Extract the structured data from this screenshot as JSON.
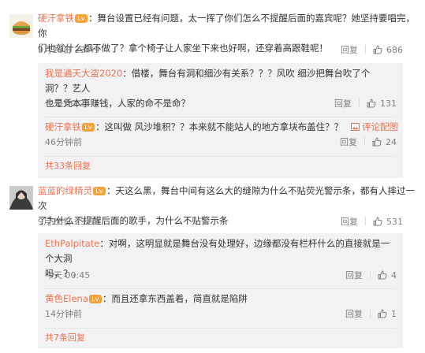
{
  "comments": [
    {
      "user": "硬汗拿铁",
      "badge": "Lv",
      "text_line1": "：舞台设置已经有问题，太一挥了你们怎么不提醒后面的嘉宾呢？她坚持要唱完，你",
      "text_line2": "们也就什么都不做了？拿个椅子让人家坐下来也好啊，还穿着高跟鞋呢！",
      "time": "9月26日 23:49",
      "reply_label": "回复",
      "likes": "686",
      "replies": [
        {
          "user": "我是通天大盗2020",
          "text_line1": "：借楼，舞台有洞和细沙有关系？？？风吹 细沙把舞台吹了个洞？？艺人",
          "text_line2": "也是凭本事赚钱，人家的命不是命？",
          "time": "今天 00:23",
          "reply_label": "回复",
          "likes": "131"
        },
        {
          "user": "硬汗拿铁",
          "badge": "Lv",
          "text_line1": "：这叫做 风沙堆积？？本来就不能站人的地方拿块布盖住？？",
          "pic_label": "评论配图",
          "time": "46分钟前",
          "reply_label": "回复",
          "likes": "24"
        }
      ],
      "more_label": "共33条回复"
    },
    {
      "user": "蓝蓝的绿精灵",
      "badge": "Lv",
      "text_line1": "：天这么黑，舞台中间有这么大的缝隙为什么不贴荧光警示条，都有人摔过一次",
      "text_line2": "了为什么不提醒后面的歌手，为什么不贴警示条",
      "time": "9月26日 23:53",
      "reply_label": "回复",
      "likes": "531",
      "replies": [
        {
          "user": "EthPalpitate",
          "text_line1": "：对啊，这明显就是舞台没有处理好，边缘都没有栏杆什么的直接就是一个大洞",
          "text_line2": "吗，？，",
          "time": "今天 00:45",
          "reply_label": "回复",
          "likes": "4"
        },
        {
          "user": "黄色Elena",
          "badge": "Lv",
          "text_line1": "：而且还拿东西盖着，简直就是陷阱",
          "time": "14分钟前",
          "reply_label": "回复",
          "likes": "1"
        }
      ],
      "more_label": "共7条回复"
    }
  ]
}
